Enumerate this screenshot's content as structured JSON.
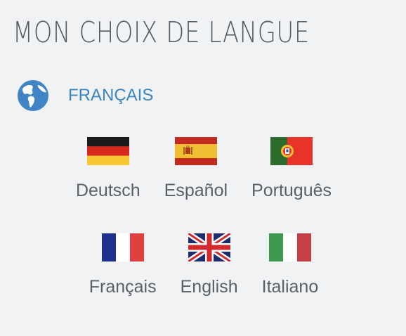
{
  "header": {
    "title": "MON CHOIX DE LANGUE"
  },
  "current": {
    "label": "FRANÇAIS",
    "icon": "globe-icon",
    "color": "#3a86c2"
  },
  "languages": [
    {
      "label": "Deutsch",
      "flag": "germany-flag-icon"
    },
    {
      "label": "Español",
      "flag": "spain-flag-icon"
    },
    {
      "label": "Português",
      "flag": "portugal-flag-icon"
    },
    {
      "label": "Français",
      "flag": "france-flag-icon"
    },
    {
      "label": "English",
      "flag": "uk-flag-icon"
    },
    {
      "label": "Italiano",
      "flag": "italy-flag-icon"
    }
  ]
}
